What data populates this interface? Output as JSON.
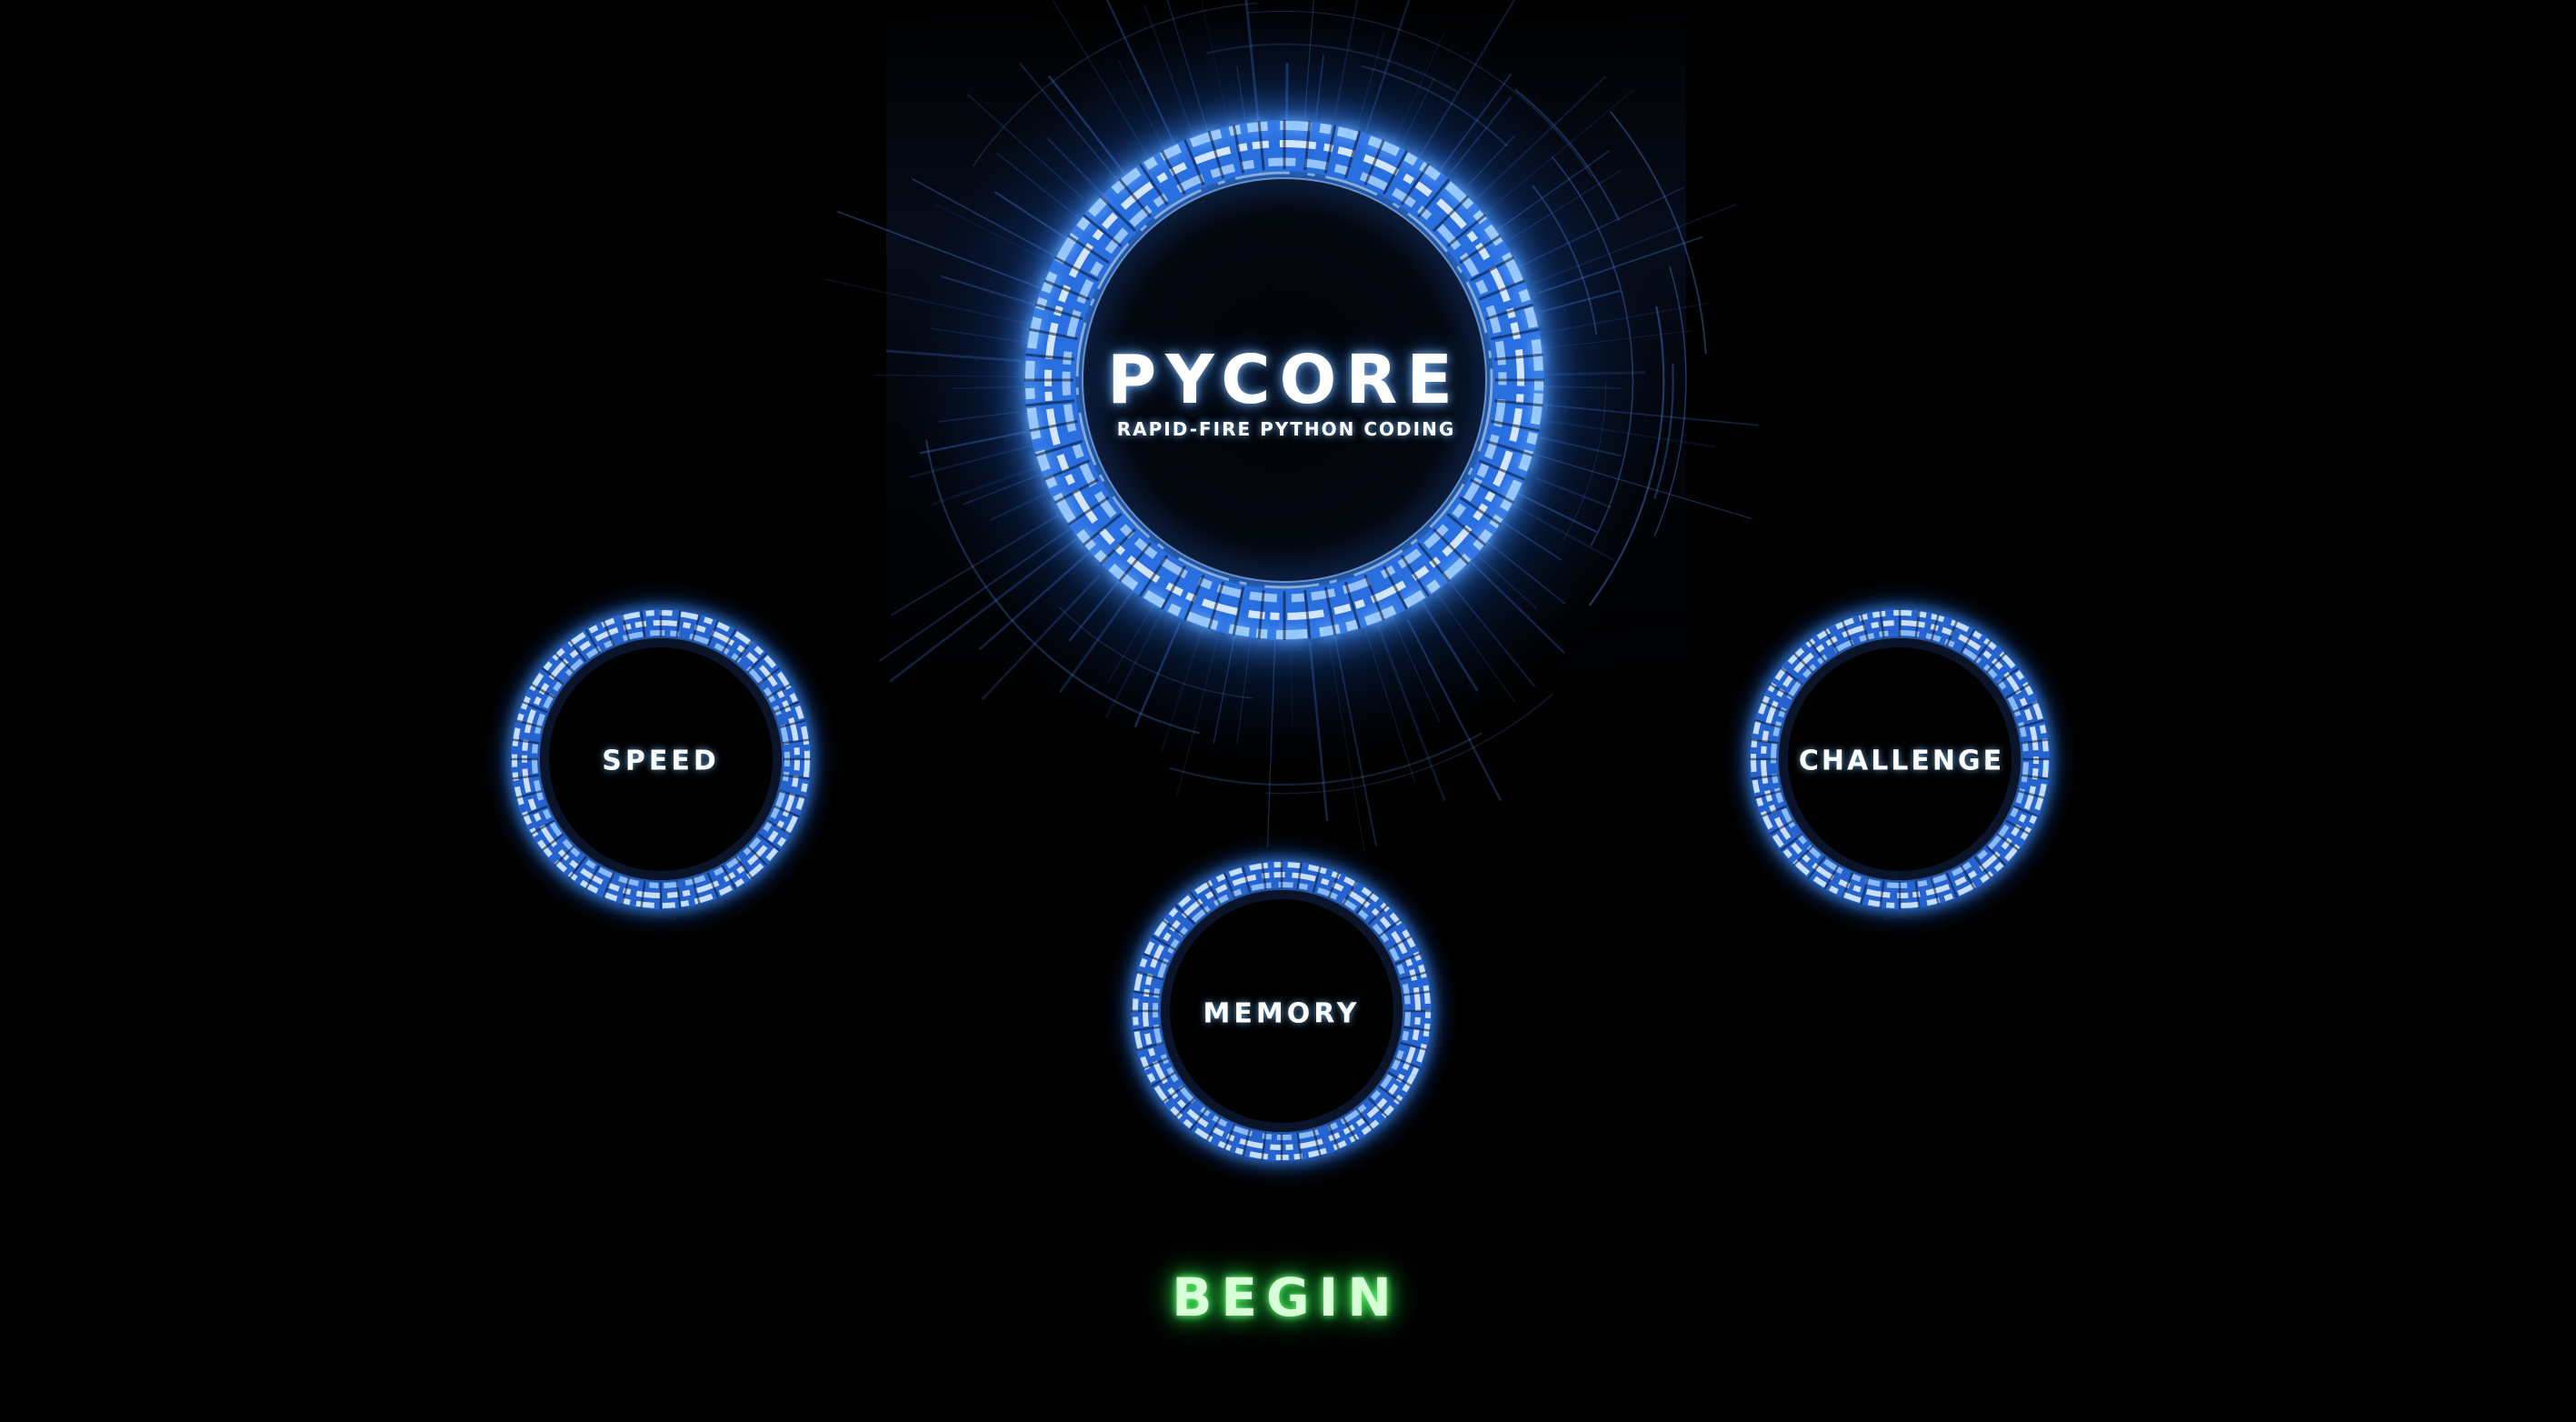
{
  "title": "PYCORE",
  "subtitle": "RAPID-FIRE PYTHON CODING",
  "modes": [
    {
      "id": "speed",
      "label": "SPEED"
    },
    {
      "id": "challenge",
      "label": "CHALLENGE"
    },
    {
      "id": "memory",
      "label": "MEMORY"
    }
  ],
  "begin_label": "BEGIN",
  "colors": {
    "background": "#000000",
    "ring_glow": "#3d8fff",
    "ring_core": "#cfe7ff",
    "text": "#ffffff",
    "begin_glow": "#3cff5a"
  },
  "icons": {
    "main_ring": "segmented-glow-ring",
    "mode_ring": "segmented-glow-ring"
  }
}
